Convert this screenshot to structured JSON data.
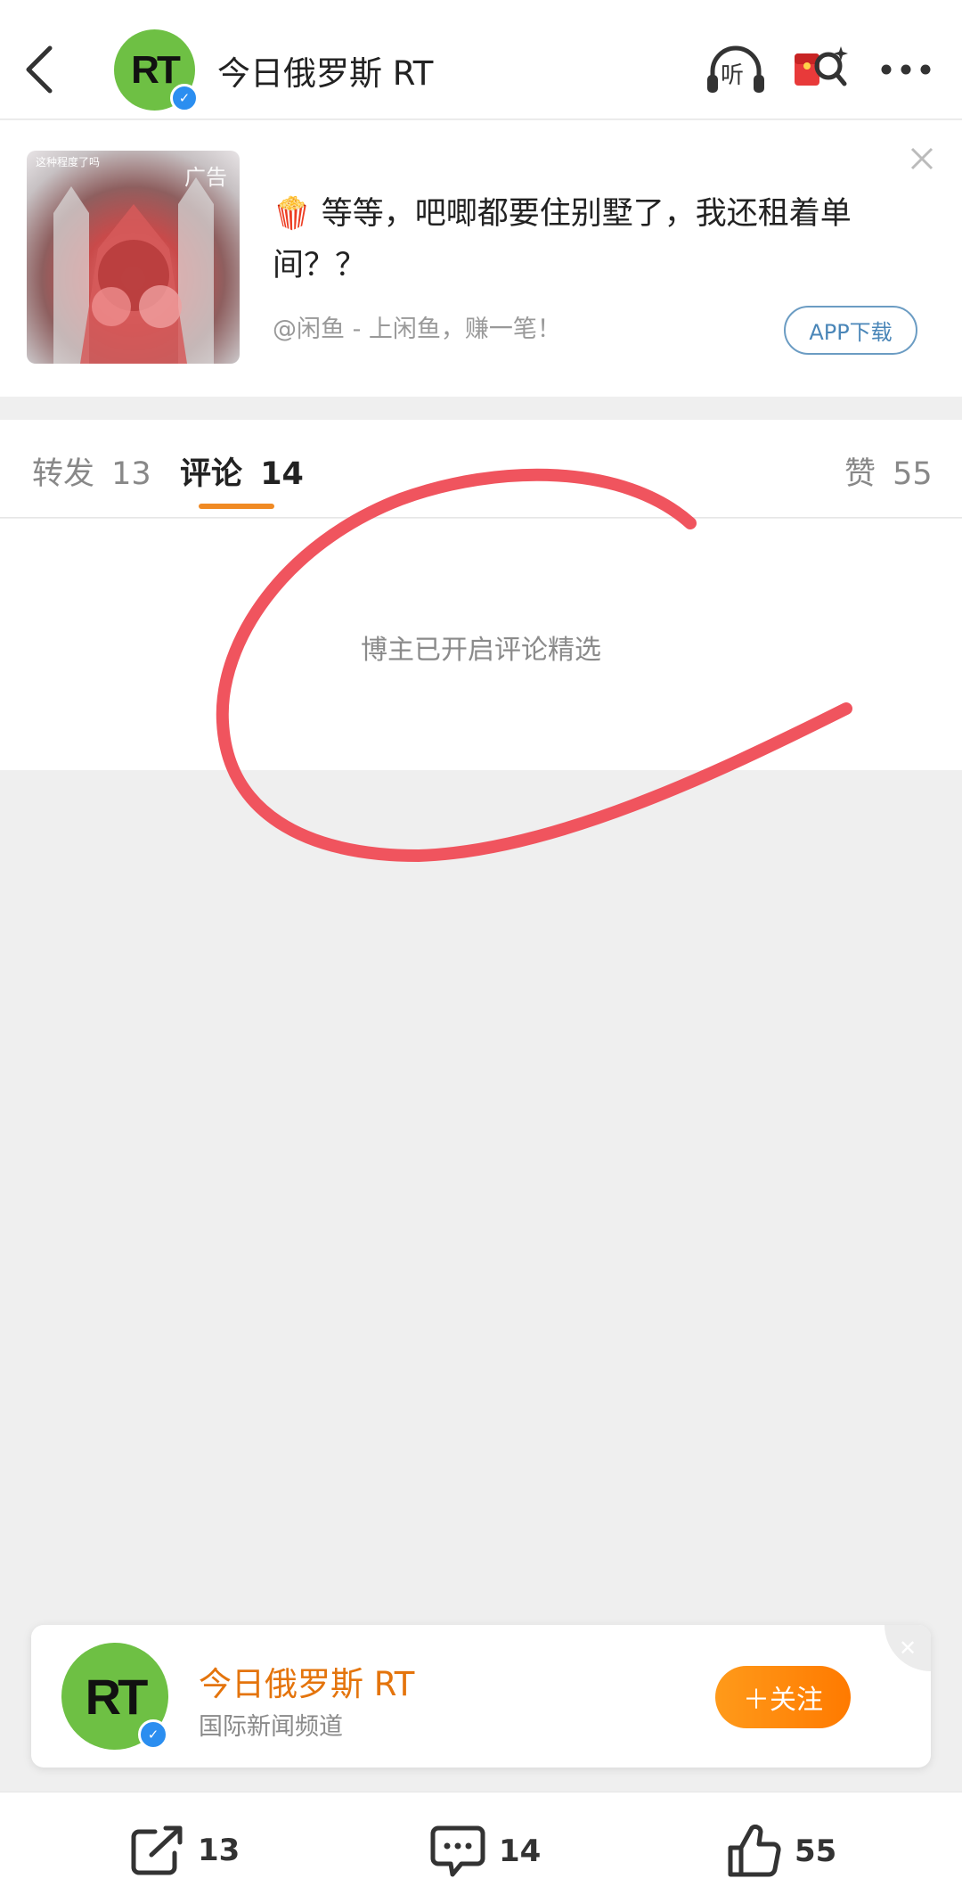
{
  "header": {
    "title": "今日俄罗斯 RT",
    "avatar_text": "RT",
    "listen_label": "听",
    "icons": [
      "back-chevron-icon",
      "headphones-listen-icon",
      "red-packet-icon",
      "more-icon"
    ]
  },
  "ad": {
    "image_top_text": "这种程度了吗",
    "image_badge": "广告",
    "text": "🍿 等等，吧唧都要住别墅了，我还租着单间？？",
    "source": "@闲鱼 - 上闲鱼，赚一笔！",
    "button": "APP下载"
  },
  "tabs": [
    {
      "label": "转发",
      "count": "13"
    },
    {
      "label": "评论",
      "count": "14",
      "active": true
    },
    {
      "label": "赞",
      "count": "55"
    }
  ],
  "comments": {
    "notice": "博主已开启评论精选"
  },
  "follow_card": {
    "name": "今日俄罗斯 RT",
    "subtitle": "国际新闻频道",
    "button": "＋关注",
    "avatar_text": "RT"
  },
  "bottom_bar": {
    "repost_count": "13",
    "comment_count": "14",
    "like_count": "55"
  },
  "colors": {
    "accent_orange": "#f08a24",
    "annotation_red": "#f0545e",
    "avatar_green": "#6ec044",
    "verified_blue": "#2b8ef0"
  }
}
